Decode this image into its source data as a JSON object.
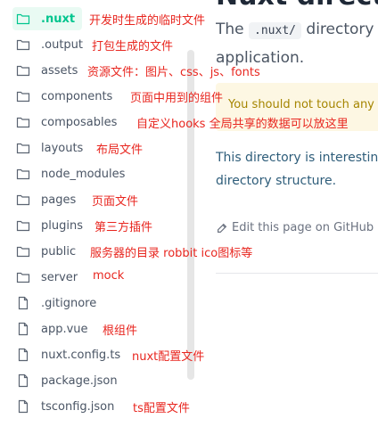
{
  "tree": [
    {
      "name": ".nuxt",
      "type": "folder",
      "note": "开发时生成的临时文件",
      "active": true
    },
    {
      "name": ".output",
      "type": "folder",
      "note": "打包生成的文件"
    },
    {
      "name": "assets",
      "type": "folder",
      "note": "资源文件：图片、css、js、fonts"
    },
    {
      "name": "components",
      "type": "folder",
      "note": "页面中用到的组件"
    },
    {
      "name": "composables",
      "type": "folder",
      "note": "自定义hooks 全局共享的数据可以放这里"
    },
    {
      "name": "layouts",
      "type": "folder",
      "note": "布局文件"
    },
    {
      "name": "node_modules",
      "type": "folder",
      "note": ""
    },
    {
      "name": "pages",
      "type": "folder",
      "note": "页面文件"
    },
    {
      "name": "plugins",
      "type": "folder",
      "note": "第三方插件"
    },
    {
      "name": "public",
      "type": "folder",
      "note": "服务器的目录  robbit    ico图标等"
    },
    {
      "name": "server",
      "type": "folder",
      "note": "mock"
    },
    {
      "name": ".gitignore",
      "type": "file",
      "note": ""
    },
    {
      "name": "app.vue",
      "type": "file",
      "note": "根组件"
    },
    {
      "name": "nuxt.config.ts",
      "type": "file",
      "note": "nuxt配置文件"
    },
    {
      "name": "package.json",
      "type": "file",
      "note": ""
    },
    {
      "name": "tsconfig.json",
      "type": "file",
      "note": "ts配置文件"
    }
  ],
  "content": {
    "title_fragment": "Nuxt directory",
    "intro_prefix": "The",
    "intro_code": ".nuxt/",
    "intro_suffix": "directory",
    "intro_line2": "application.",
    "warning": "You should not touch any f",
    "body_line1": "This directory is interestin",
    "body_line2": "directory structure.",
    "edit_link": "Edit this page on GitHub"
  },
  "colors": {
    "accent": "#00c58e",
    "annotation": "#e8261f",
    "warning_bg": "#fdf7e3"
  }
}
